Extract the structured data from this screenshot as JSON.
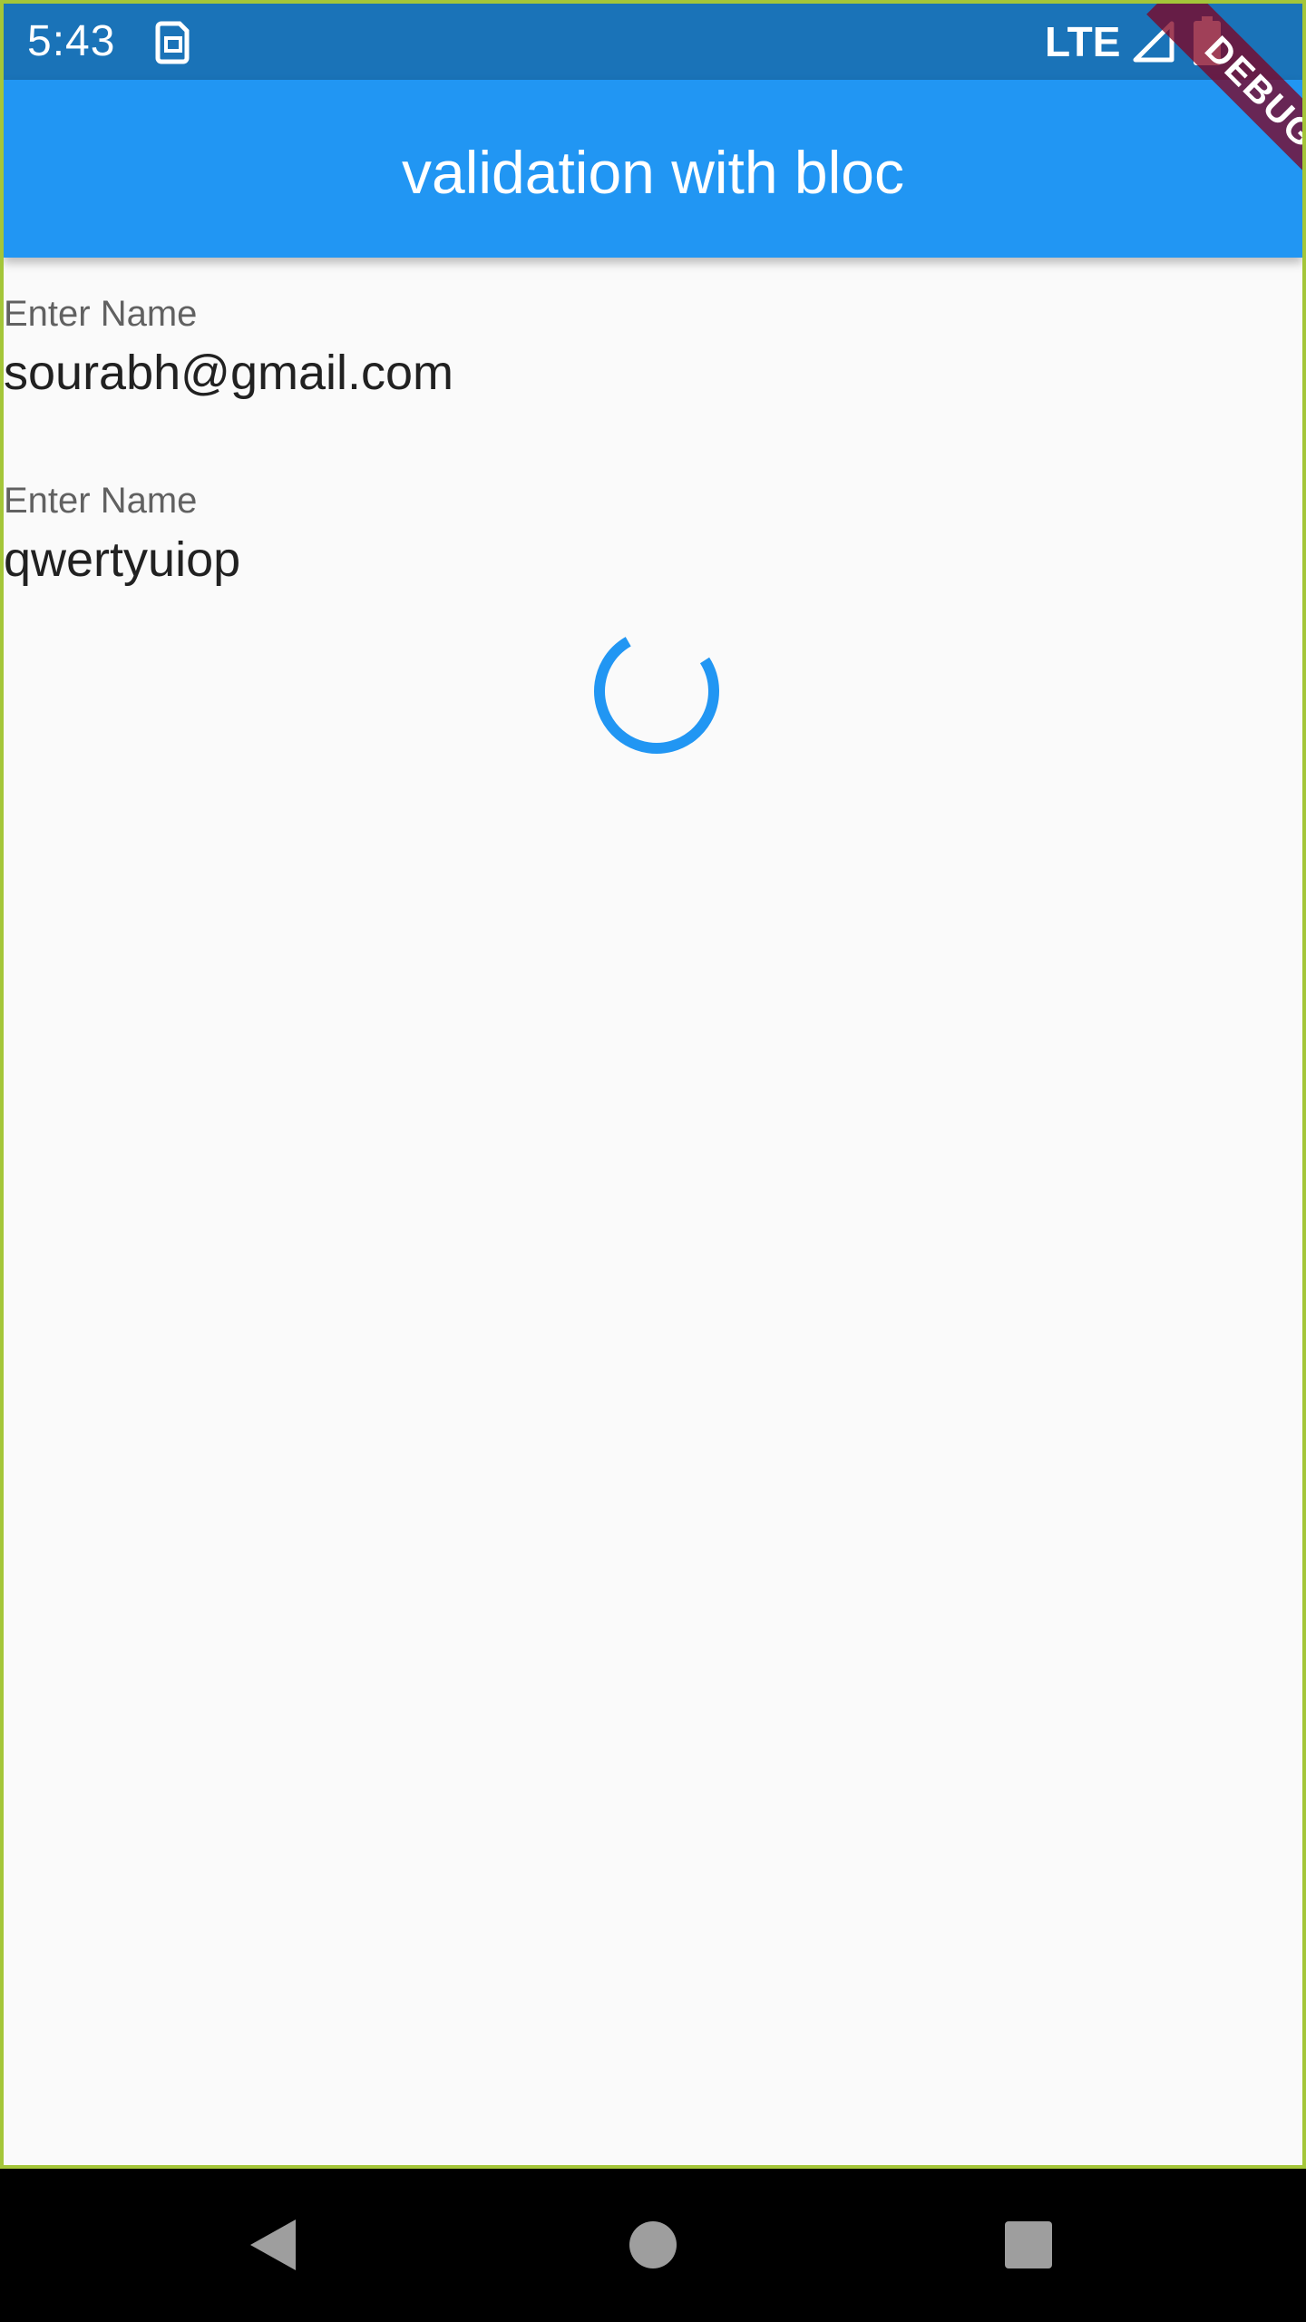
{
  "status_bar": {
    "time": "5:43",
    "network": "LTE",
    "icons": [
      "sim-card-icon",
      "signal-icon",
      "battery-icon"
    ]
  },
  "app_bar": {
    "title": "validation with bloc",
    "color": "#2196f3"
  },
  "debug_banner": {
    "text": "DEBUG"
  },
  "form": {
    "fields": [
      {
        "label": "Enter Name",
        "value": "sourabh@gmail.com"
      },
      {
        "label": "Enter Name",
        "value": "qwertyuiop"
      }
    ]
  },
  "loading": {
    "icon": "loading-spinner",
    "color": "#2196f3"
  },
  "nav_bar": {
    "icons": [
      "back-icon",
      "home-icon",
      "recents-icon"
    ]
  }
}
